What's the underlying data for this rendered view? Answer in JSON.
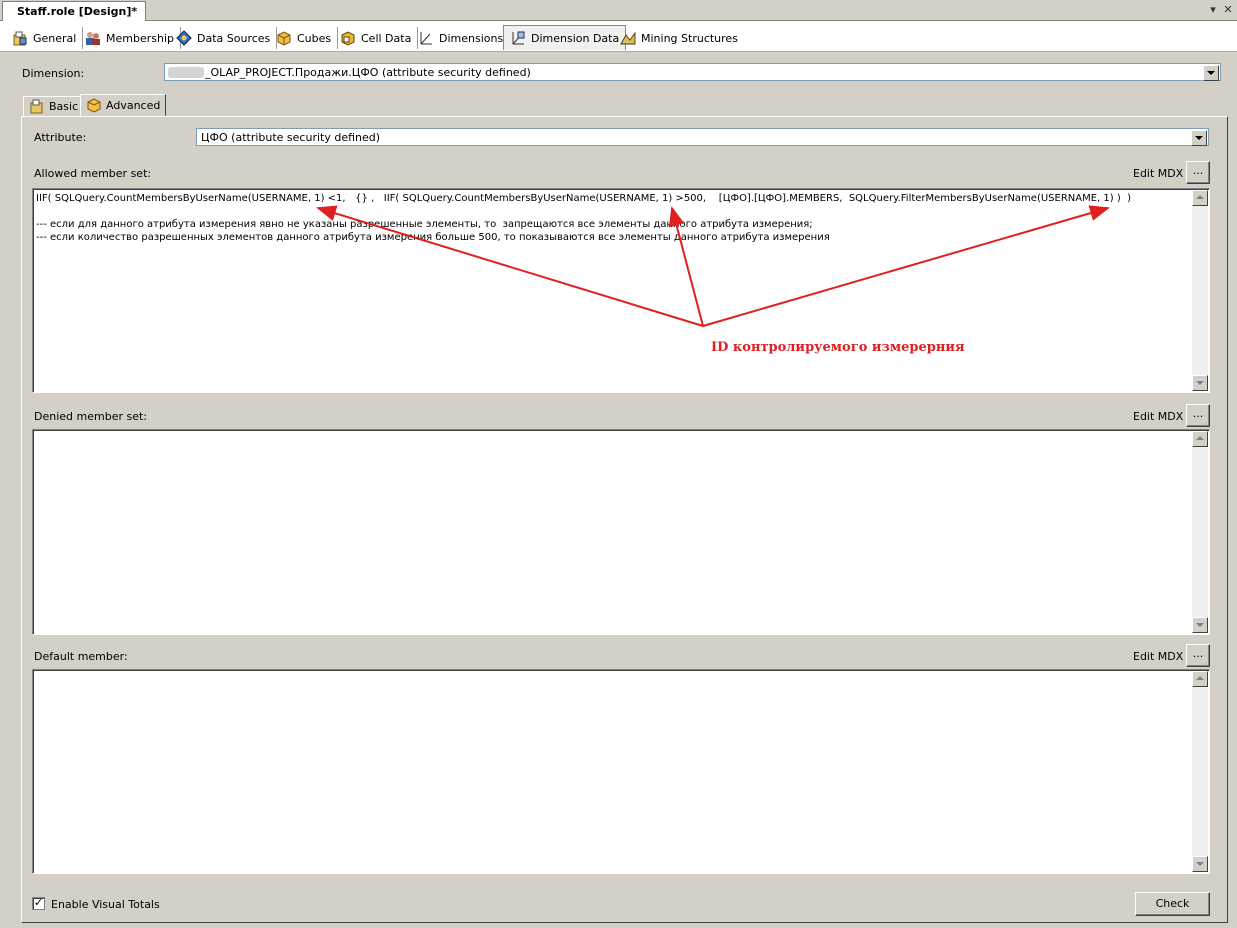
{
  "document_tab": {
    "title": "Staff.role [Design]*"
  },
  "window_controls": {
    "dropdown_glyph": "▾",
    "close_glyph": "✕"
  },
  "designer_tabs": [
    {
      "label": "General",
      "icon": "general-icon"
    },
    {
      "label": "Membership",
      "icon": "membership-icon"
    },
    {
      "label": "Data Sources",
      "icon": "data-sources-icon"
    },
    {
      "label": "Cubes",
      "icon": "cubes-icon"
    },
    {
      "label": "Cell Data",
      "icon": "cell-data-icon"
    },
    {
      "label": "Dimensions",
      "icon": "dimensions-icon"
    },
    {
      "label": "Dimension Data",
      "icon": "dimension-data-icon",
      "active": true
    },
    {
      "label": "Mining Structures",
      "icon": "mining-structures-icon"
    }
  ],
  "dimension": {
    "label": "Dimension:",
    "value": "_OLAP_PROJECT.Продажи.ЦФО (attribute security defined)"
  },
  "sub_tabs": [
    {
      "label": "Basic",
      "icon": "basic-icon"
    },
    {
      "label": "Advanced",
      "icon": "advanced-icon",
      "active": true
    }
  ],
  "attribute": {
    "label": "Attribute:",
    "value": "ЦФО (attribute security defined)"
  },
  "allowed": {
    "label": "Allowed member set:",
    "edit_mdx": "Edit MDX",
    "ellipsis": "...",
    "lines": [
      "IIF( SQLQuery.CountMembersByUserName(USERNAME, 1) <1,   {} ,   IIF( SQLQuery.CountMembersByUserName(USERNAME, 1) >500,    [ЦФО].[ЦФО].MEMBERS,  SQLQuery.FilterMembersByUserName(USERNAME, 1) )  )",
      "",
      "--- если для данного атрибута измерения явно не указаны разрешенные элементы, то  запрещаются все элементы данного атрибута измерения;",
      "--- если количество разрешенных элементов данного атрибута измерения больше 500, то показываются все элементы данного атрибута измерения"
    ],
    "annotation": "ID контролируемого  измерерния"
  },
  "denied": {
    "label": "Denied member set:",
    "edit_mdx": "Edit MDX",
    "ellipsis": "..."
  },
  "default_member": {
    "label": "Default member:",
    "edit_mdx": "Edit MDX",
    "ellipsis": "..."
  },
  "visual_totals": {
    "label": "Enable Visual Totals",
    "checked": true,
    "check_glyph": "✓"
  },
  "check_button": {
    "label": "Check"
  },
  "colors": {
    "annotation": "#e02020",
    "window_bg": "#d4d0c8"
  }
}
